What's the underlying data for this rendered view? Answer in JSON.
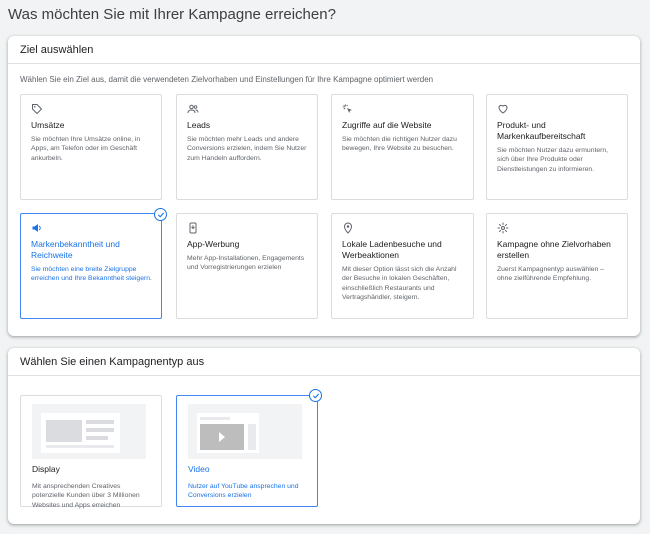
{
  "page_title": "Was möchten Sie mit Ihrer Kampagne erreichen?",
  "goal_section": {
    "header": "Ziel auswählen",
    "description": "Wählen Sie ein Ziel aus, damit die verwendeten Zielvorhaben und Einstellungen für Ihre Kampagne optimiert werden",
    "tiles": [
      {
        "icon": "tag-icon",
        "title": "Umsätze",
        "desc": "Sie möchten Ihre Umsätze online, in Apps, am Telefon oder im Geschäft ankurbeln."
      },
      {
        "icon": "people-icon",
        "title": "Leads",
        "desc": "Sie möchten mehr Leads und andere Conversions erzielen, indem Sie Nutzer zum Handeln auffordern."
      },
      {
        "icon": "cursor-click-icon",
        "title": "Zugriffe auf die Website",
        "desc": "Sie möchten die richtigen Nutzer dazu bewegen, Ihre Website zu besuchen."
      },
      {
        "icon": "heart-icon",
        "title": "Produkt- und Markenkaufbereitschaft",
        "desc": "Sie möchten Nutzer dazu ermuntern, sich über Ihre Produkte oder Dienstleistungen zu informieren."
      },
      {
        "icon": "megaphone-icon",
        "title": "Markenbekanntheit und Reichweite",
        "desc": "Sie möchten eine breite Zielgruppe erreichen und Ihre Bekanntheit steigern.",
        "selected": true
      },
      {
        "icon": "phone-download-icon",
        "title": "App-Werbung",
        "desc": "Mehr App-Installationen, Engagements und Vorregistrierungen erzielen"
      },
      {
        "icon": "location-pin-icon",
        "title": "Lokale Ladenbesuche und Werbeaktionen",
        "desc": "Mit dieser Option lässt sich die Anzahl der Besuche in lokalen Geschäften, einschließlich Restaurants und Vertragshändler, steigern."
      },
      {
        "icon": "gear-icon",
        "title": "Kampagne ohne Zielvorhaben erstellen",
        "desc": "Zuerst Kampagnentyp auswählen – ohne zielführende Empfehlung."
      }
    ]
  },
  "type_section": {
    "header": "Wählen Sie einen Kampagnentyp aus",
    "tiles": [
      {
        "icon": "display-thumbnail",
        "title": "Display",
        "desc": "Mit ansprechenden Creatives potenzielle Kunden über 3 Millionen Websites und Apps erreichen"
      },
      {
        "icon": "video-thumbnail",
        "title": "Video",
        "desc": "Nutzer auf YouTube ansprechen und Conversions erzielen",
        "selected": true
      }
    ]
  },
  "colors": {
    "accent": "#1a73e8",
    "selected_border": "#4285f4",
    "background": "#f1f3f4"
  }
}
